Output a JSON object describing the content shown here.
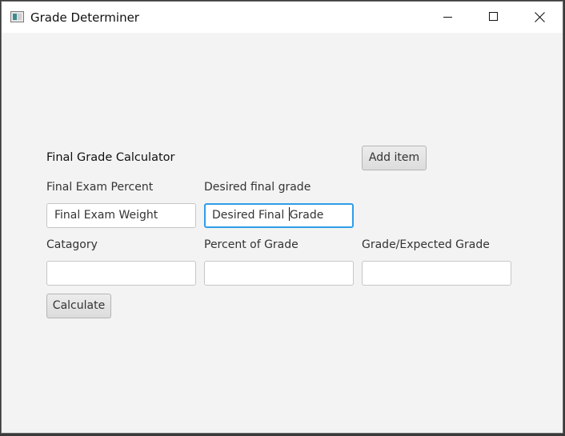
{
  "window": {
    "title": "Grade Determiner",
    "controls": {
      "minimize": "minimize-icon",
      "maximize": "maximize-icon",
      "close": "close-icon"
    }
  },
  "form": {
    "heading": "Final Grade Calculator",
    "add_item_label": "Add item",
    "final_exam_percent_label": "Final Exam Percent",
    "final_exam_weight_value": "Final Exam Weight",
    "desired_final_grade_label": "Desired final grade",
    "desired_final_grade_before_caret": "Desired Final ",
    "desired_final_grade_after_caret": "Grade",
    "category_label": "Catagory",
    "percent_of_grade_label": "Percent of Grade",
    "grade_expected_label": "Grade/Expected Grade",
    "category_value": "",
    "percent_of_grade_value": "",
    "grade_expected_value": "",
    "calculate_label": "Calculate"
  },
  "colors": {
    "focus_border": "#2f9de8",
    "window_bg": "#f3f3f3"
  }
}
